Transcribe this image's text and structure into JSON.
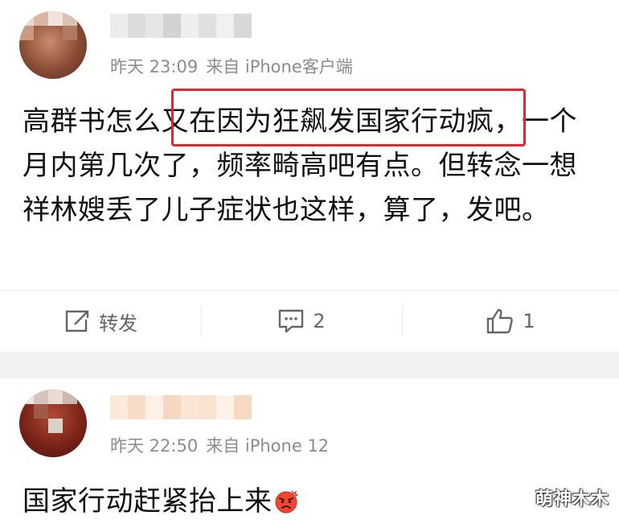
{
  "posts": [
    {
      "meta": {
        "time": "昨天 23:09",
        "source": "来自 iPhone客户端"
      },
      "content": "高群书怎么又在因为狂飙发国家行动疯，一个月内第几次了，频率畸高吧有点。但转念一想祥林嫂丢了儿子症状也这样，算了，发吧。",
      "actions": {
        "repost_label": "转发",
        "comment_count": "2",
        "like_count": "1"
      }
    },
    {
      "meta": {
        "time": "昨天 22:50",
        "source": "来自 iPhone 12"
      },
      "content": "国家行动赶紧抬上来"
    }
  ],
  "watermark": "萌神木木",
  "colors": {
    "highlight_border": "#e8242c",
    "meta_text": "#8c8c8c",
    "body_text": "#111111",
    "action_text": "#666666",
    "separator": "#f2f2f2"
  },
  "icons": {
    "repost": "share-arrow-icon",
    "comment": "comment-icon",
    "like": "thumbs-up-icon",
    "emoji": "angry-face-emoji"
  }
}
